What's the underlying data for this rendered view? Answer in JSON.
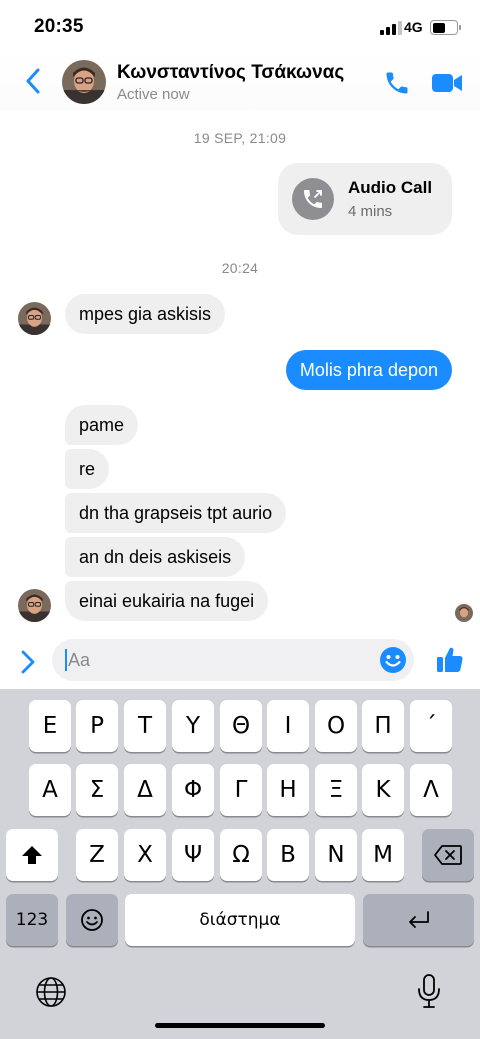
{
  "status_bar": {
    "time": "20:35",
    "network": "4G"
  },
  "header": {
    "name": "Κωνσταντίνος Τσάκωνας",
    "status": "Active now"
  },
  "messages": {
    "ts1": "19 SEP, 21:09",
    "call_title": "Audio Call",
    "call_duration": "4 mins",
    "ts2": "20:24",
    "m1": "mpes gia askisis",
    "m2": "Molis phra depon",
    "m3": "pame",
    "m4": "re",
    "m5": "dn tha grapseis tpt aurio",
    "m6": "an dn deis askiseis",
    "m7": "einai eukairia na fugei"
  },
  "composer": {
    "placeholder": "Aa"
  },
  "keyboard": {
    "row1": [
      "Ε",
      "Ρ",
      "Τ",
      "Υ",
      "Θ",
      "Ι",
      "Ο",
      "Π",
      "΄"
    ],
    "row2": [
      "Α",
      "Σ",
      "Δ",
      "Φ",
      "Γ",
      "Η",
      "Ξ",
      "Κ",
      "Λ"
    ],
    "row3": [
      "Ζ",
      "Χ",
      "Ψ",
      "Ω",
      "Β",
      "Ν",
      "Μ"
    ],
    "numbers_label": "123",
    "space_label": "διάστημα"
  },
  "colors": {
    "accent": "#1a8cff",
    "incoming_bubble": "#efeff0",
    "keyboard_bg": "#d1d3d9"
  },
  "icons": [
    "back-chevron-icon",
    "phone-icon",
    "video-camera-icon",
    "missed-call-icon",
    "emoji-smile-icon",
    "thumbs-up-icon",
    "shift-arrow-icon",
    "backspace-icon",
    "emoji-icon",
    "return-icon",
    "globe-icon",
    "microphone-icon"
  ]
}
